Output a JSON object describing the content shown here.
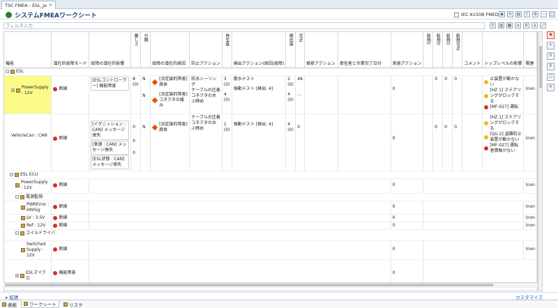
{
  "tab": {
    "label": "TSC FMEA - ESL_ja",
    "close": "✕"
  },
  "header": {
    "title": "システムFMEAワークシート",
    "iec_label": "IEC 61508 FMEDA"
  },
  "filter": {
    "placeholder": "フィルタ入力"
  },
  "columns": [
    "機能",
    "潜在的故障モード",
    "故障の潜在的影響",
    "厳しさ",
    "分類",
    "故障の潜在的原因",
    "防止アクション",
    "発生度",
    "検出アクション(原因/故障)",
    "検出度",
    "RPN",
    "推奨アクション",
    "責任者と作業完了日付",
    "実施アクション",
    "新規S",
    "新規O",
    "新規D",
    "新規RPN",
    "コメント",
    "トップレベルの影響",
    "関連"
  ],
  "rows": {
    "esl": "ESL",
    "ps12": "PowerSupply : 12V",
    "fm_break": "断線",
    "eff_esl_ctrl": "[ESLコントローラー] 機能障害",
    "sev_8": "8 (0)",
    "cls_n": "N",
    "cause_design": "[決定論的障害] 腐食",
    "cause_connector": "[決定論的障害] コネクタの緩み",
    "prev_sealing": "防水シーリング",
    "prev_cable": "ケーブルの圧着",
    "prev_connector": "コネクタの水ぶ締め",
    "occ_3": "3 (0)",
    "occ_4": "4 (0)",
    "det_water": "散水テスト",
    "det_vib": "振動テスト [検出: 4]",
    "det_2": "2 (0)",
    "det_4": "4 (0)",
    "rpn_48": "48",
    "dots": "...",
    "zero": "0",
    "top1": "止装置が動かない",
    "top2": "[HZ 1] ステアリングがロックする",
    "top3": "[MF-027] 運転",
    "vehiclecan": "VehicleCan : CAN",
    "eff_ign": "[イグニッション : CAN] メッセージ喪失",
    "eff_speed": "[車速 : CAN] メッセージ喪失",
    "eff_eslstat": "[ESL状態 : CAN] メッセージ喪失",
    "occ_1": "1 (0)",
    "top4": "[HZ 1] ステアリングがロックする",
    "top5": "[QU 2] 盗難防止装置が動かない",
    "top6": "[MF-027] 運転者情報がない",
    "esl_ecu": "ESL ECU",
    "ps12b": "PowerSupply : 12V",
    "power_mon": "電源監視",
    "pwrerror": "PWRError : HWSig",
    "lv": "LV : 3.5V",
    "ref": "Ref : 12V",
    "coil": "コイルドライバ",
    "switched": "Switched Supply : 12V",
    "eslmicro": "ESLマイクロ",
    "fm_func": "機能障害",
    "non": "(non"
  },
  "bottom": {
    "expand": "拡張",
    "customize": "カスタマイズ"
  },
  "bottom_tabs": [
    "表紙",
    "ワークシート",
    "リスク"
  ]
}
